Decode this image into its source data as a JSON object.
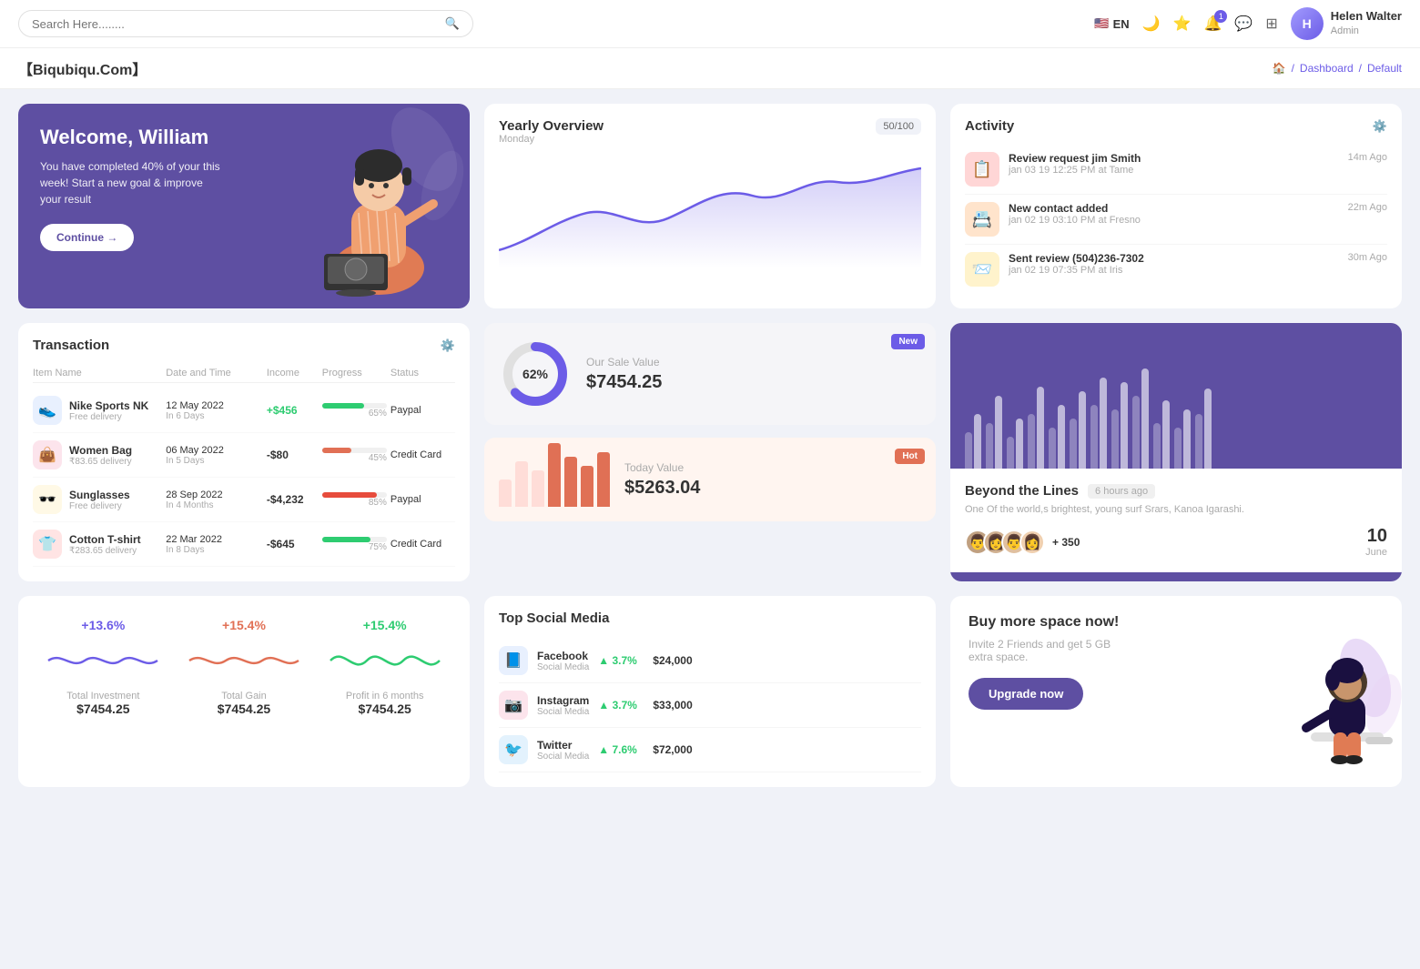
{
  "topnav": {
    "search_placeholder": "Search Here........",
    "lang": "EN",
    "notification_badge": "1",
    "user_name": "Helen Walter",
    "user_role": "Admin"
  },
  "breadcrumb": {
    "logo": "【Biqubiqu.Com】",
    "items": [
      "Dashboard",
      "Default"
    ]
  },
  "welcome": {
    "title": "Welcome, William",
    "subtitle": "You have completed 40% of your this week! Start a new goal & improve your result",
    "button": "Continue →"
  },
  "yearly_overview": {
    "title": "Yearly Overview",
    "day": "Monday",
    "badge": "50/100"
  },
  "activity": {
    "title": "Activity",
    "items": [
      {
        "title": "Review request jim Smith",
        "sub": "jan 03 19 12:25 PM at Tame",
        "time": "14m Ago"
      },
      {
        "title": "New contact added",
        "sub": "jan 02 19 03:10 PM at Fresno",
        "time": "22m Ago"
      },
      {
        "title": "Sent review (504)236-7302",
        "sub": "jan 02 19 07:35 PM at Iris",
        "time": "30m Ago"
      }
    ]
  },
  "transaction": {
    "title": "Transaction",
    "columns": [
      "Item Name",
      "Date and Time",
      "Income",
      "Progress",
      "Status"
    ],
    "rows": [
      {
        "name": "Nike Sports NK",
        "sub": "Free delivery",
        "icon": "👟",
        "icon_bg": "#e8f0fe",
        "date": "12 May 2022",
        "date_sub": "In 6 Days",
        "income": "+$456",
        "income_type": "pos",
        "progress": 65,
        "progress_color": "#2ecc71",
        "status": "Paypal"
      },
      {
        "name": "Women Bag",
        "sub": "₹83.65 delivery",
        "icon": "👜",
        "icon_bg": "#fce4ec",
        "date": "06 May 2022",
        "date_sub": "In 5 Days",
        "income": "-$80",
        "income_type": "neg",
        "progress": 45,
        "progress_color": "#e17055",
        "status": "Credit Card"
      },
      {
        "name": "Sunglasses",
        "sub": "Free delivery",
        "icon": "🕶️",
        "icon_bg": "#fff9e6",
        "date": "28 Sep 2022",
        "date_sub": "In 4 Months",
        "income": "-$4,232",
        "income_type": "neg",
        "progress": 85,
        "progress_color": "#e74c3c",
        "status": "Paypal"
      },
      {
        "name": "Cotton T-shirt",
        "sub": "₹283.65 delivery",
        "icon": "👕",
        "icon_bg": "#ffe4e4",
        "date": "22 Mar 2022",
        "date_sub": "In 8 Days",
        "income": "-$645",
        "income_type": "neg",
        "progress": 75,
        "progress_color": "#2ecc71",
        "status": "Credit Card"
      }
    ]
  },
  "sale_new": {
    "badge": "New",
    "donut_pct": "62%",
    "donut_value": 62,
    "label": "Our Sale Value",
    "value": "$7454.25"
  },
  "sale_hot": {
    "badge": "Hot",
    "label": "Today Value",
    "value": "$5263.04",
    "bars": [
      30,
      50,
      40,
      70,
      55,
      45,
      60
    ]
  },
  "beyond": {
    "title": "Beyond the Lines",
    "time_ago": "6 hours ago",
    "desc": "One Of the world,s brightest, young surf Srars, Kanoa Igarashi.",
    "plus_count": "+ 350",
    "date_day": "10",
    "date_month": "June"
  },
  "stats": [
    {
      "percent": "+13.6%",
      "label": "Total Investment",
      "value": "$7454.25",
      "color": "#6c5ce7"
    },
    {
      "percent": "+15.4%",
      "label": "Total Gain",
      "value": "$7454.25",
      "color": "#e17055"
    },
    {
      "percent": "+15.4%",
      "label": "Profit in 6 months",
      "value": "$7454.25",
      "color": "#2ecc71"
    }
  ],
  "social": {
    "title": "Top Social Media",
    "items": [
      {
        "name": "Facebook",
        "sub": "Social Media",
        "change": "3.7%",
        "amount": "$24,000",
        "icon": "📘",
        "type": "fb"
      },
      {
        "name": "Instagram",
        "sub": "Social Media",
        "change": "3.7%",
        "amount": "$33,000",
        "icon": "📷",
        "type": "ig"
      },
      {
        "name": "Twitter",
        "sub": "Social Media",
        "change": "7.6%",
        "amount": "$72,000",
        "icon": "🐦",
        "type": "tw"
      }
    ]
  },
  "buy_space": {
    "title": "Buy more space now!",
    "desc": "Invite 2 Friends and get 5 GB extra space.",
    "button": "Upgrade now"
  }
}
